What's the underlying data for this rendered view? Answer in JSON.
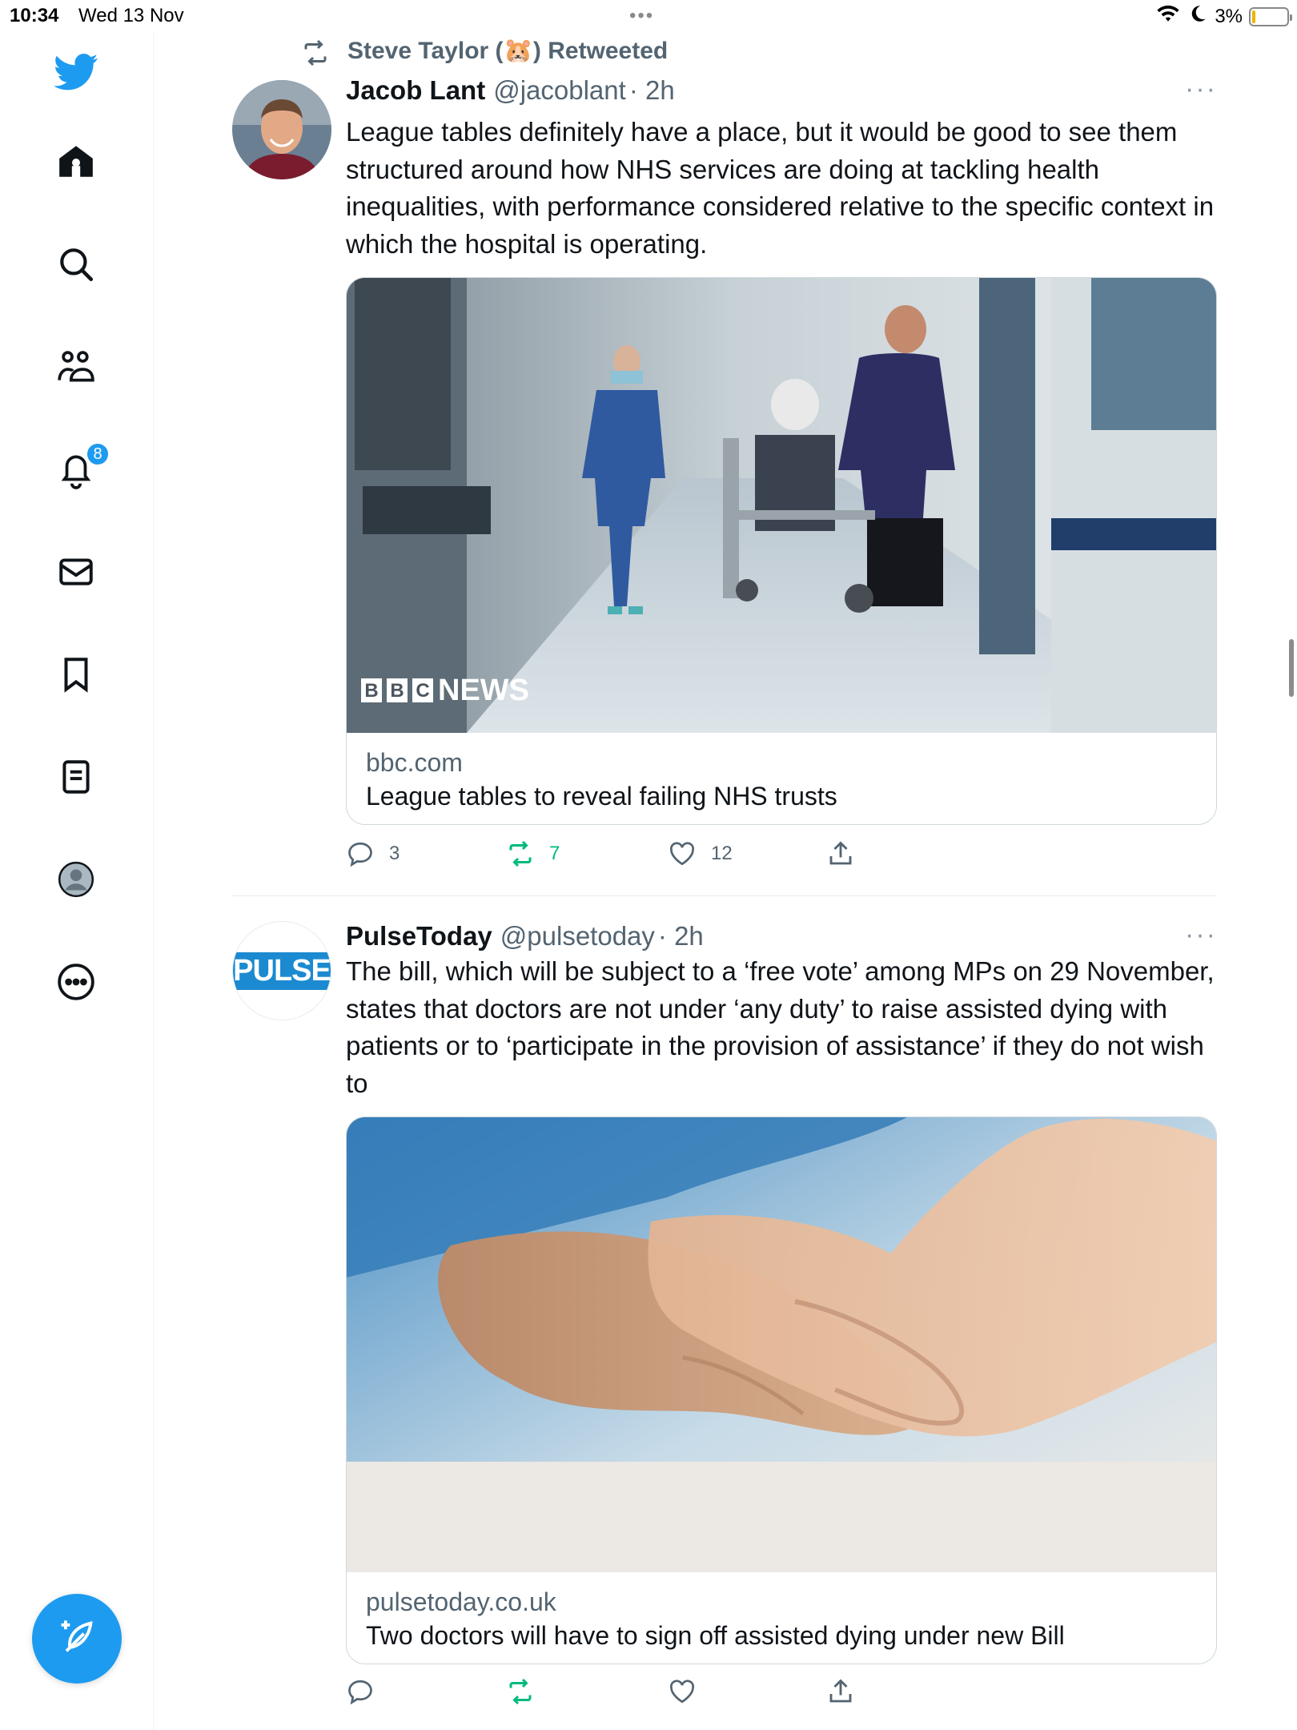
{
  "status_bar": {
    "time": "10:34",
    "date": "Wed 13 Nov",
    "battery": "3%",
    "battery_level": 0.03,
    "icons": [
      "wifi-icon",
      "moon-icon",
      "battery-icon"
    ]
  },
  "sidebar": {
    "logo": "twitter-bird-icon",
    "items": [
      {
        "name": "home",
        "icon": "home-icon"
      },
      {
        "name": "explore",
        "icon": "search-icon"
      },
      {
        "name": "communities",
        "icon": "communities-icon"
      },
      {
        "name": "notifications",
        "icon": "bell-icon",
        "badge": "8"
      },
      {
        "name": "messages",
        "icon": "mail-icon"
      },
      {
        "name": "bookmarks",
        "icon": "bookmark-icon"
      },
      {
        "name": "lists",
        "icon": "list-icon"
      },
      {
        "name": "profile",
        "icon": "profile-icon"
      },
      {
        "name": "more",
        "icon": "more-circle-icon"
      }
    ],
    "compose_icon": "compose-feather-icon"
  },
  "tweets": [
    {
      "retweet_context": "Steve Taylor (🐹) Retweeted",
      "author_name": "Jacob Lant",
      "author_handle": "@jacoblant",
      "time": "· 2h",
      "text": "League tables definitely have a place, but it would be good to see them structured around how NHS services are doing at tackling health inequalities, with performance considered relative to the specific context in which the hospital is operating.",
      "card": {
        "image_label": "BBC NEWS",
        "domain": "bbc.com",
        "title": "League tables to reveal failing NHS trusts"
      },
      "actions": {
        "replies": "3",
        "retweets": "7",
        "likes": "12"
      },
      "accent": {
        "retweet": "#00ba7c",
        "link": "#536471"
      }
    },
    {
      "author_name": "PulseToday",
      "author_handle": "@pulsetoday",
      "time": "· 2h",
      "avatar_text": "PULSE",
      "text": "The bill, which will be subject to a ‘free vote’ among MPs on 29 November, states that doctors are not under ‘any duty’ to raise assisted dying with patients or to ‘participate in the provision of assistance’ if they do not wish to",
      "card": {
        "domain": "pulsetoday.co.uk",
        "title": "Two doctors will have to sign off assisted dying under new Bill"
      },
      "actions": {
        "replies": "",
        "retweets": "",
        "likes": ""
      }
    }
  ],
  "colors": {
    "brand": "#1d9bf0",
    "retweet_green": "#00ba7c",
    "secondary_text": "#536471"
  }
}
